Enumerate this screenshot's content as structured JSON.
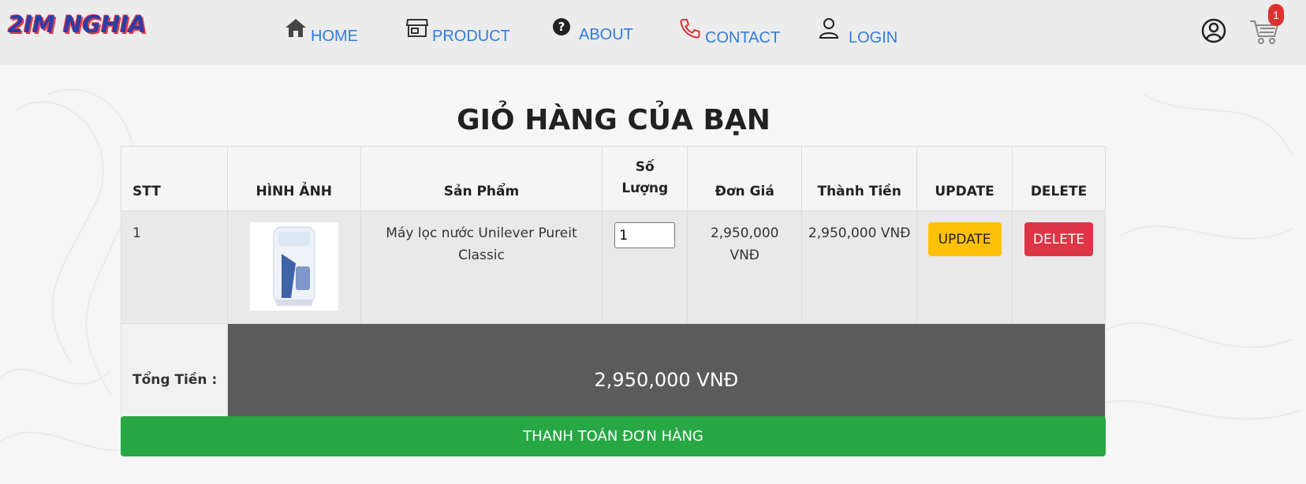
{
  "header": {
    "logo": "2IM NGHIA",
    "nav": [
      {
        "label": "HOME",
        "icon": "home-icon"
      },
      {
        "label": "PRODUCT",
        "icon": "store-icon"
      },
      {
        "label": "ABOUT",
        "icon": "question-icon"
      },
      {
        "label": "CONTACT",
        "icon": "phone-icon"
      },
      {
        "label": "LOGIN",
        "icon": "user-icon"
      }
    ],
    "cart_count": "1"
  },
  "cart": {
    "title": "GIỎ HÀNG CỦA BẠN",
    "columns": [
      "STT",
      "HÌNH ẢNH",
      "Sản Phẩm",
      "Số Lượng",
      "Đơn Giá",
      "Thành Tiền",
      "UPDATE",
      "DELETE"
    ],
    "rows": [
      {
        "stt": "1",
        "product": "Máy lọc nước Unilever Pureit Classic",
        "quantity": "1",
        "unit_price": "2,950,000 VNĐ",
        "line_total": "2,950,000 VNĐ",
        "update_label": "UPDATE",
        "delete_label": "DELETE"
      }
    ],
    "total_label": "Tổng Tiền :",
    "total_value": "2,950,000 VNĐ",
    "checkout_label": "THANH TOÁN ĐƠN HÀNG"
  },
  "colors": {
    "nav_link": "#2f7de1",
    "update_button": "#ffc107",
    "delete_button": "#dc3545",
    "checkout_button": "#28a745",
    "total_bar": "#5b5b5b",
    "total_label": "#e03131"
  }
}
